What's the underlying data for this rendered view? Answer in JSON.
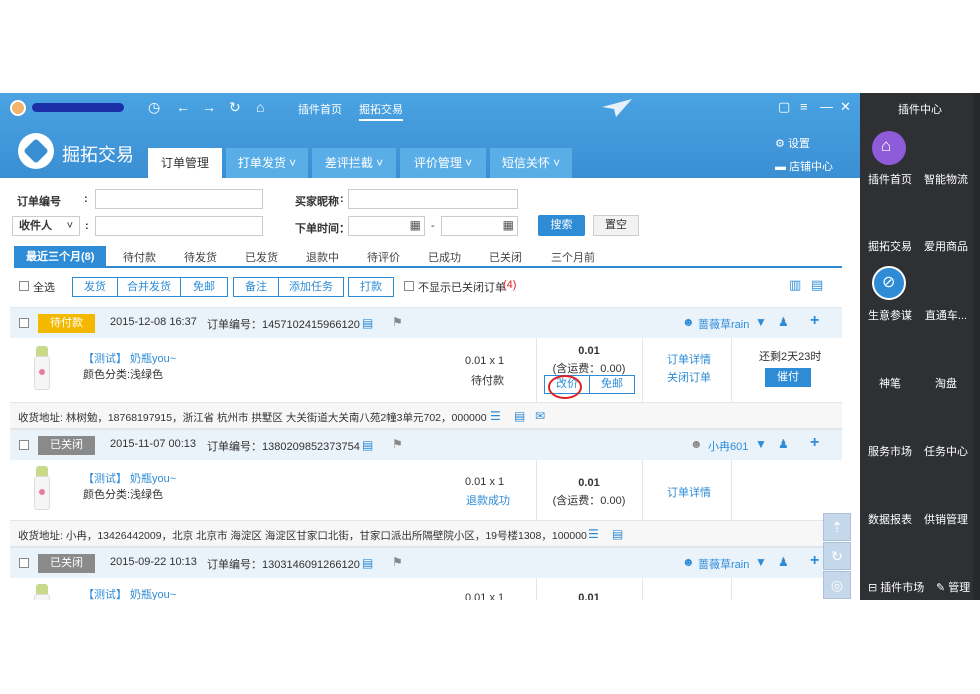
{
  "top": {
    "links": [
      "插件首页",
      "掘拓交易"
    ],
    "brand": "掘拓交易",
    "settings": "设置",
    "shop_center": "店铺中心"
  },
  "main_tabs": [
    "订单管理",
    "打单发货",
    "差评拦截",
    "评价管理",
    "短信关怀"
  ],
  "filters": {
    "order_no_label": "订单编号",
    "buyer_label": "买家昵称",
    "receiver_label": "收件人",
    "order_time_label": "下单时间：",
    "colon": ":",
    "dash": "-",
    "search": "搜索",
    "reset": "置空"
  },
  "status_tabs": [
    "最近三个月(8)",
    "待付款",
    "待发货",
    "已发货",
    "退款中",
    "待评价",
    "已成功",
    "已关闭",
    "三个月前"
  ],
  "actions": {
    "select_all": "全选",
    "buttons": [
      "发货",
      "合并发货",
      "免邮",
      "备注",
      "添加任务",
      "打款"
    ],
    "hide_closed": "不显示已关闭订单",
    "hide_closed_count": "(4)"
  },
  "orders": [
    {
      "status": "待付款",
      "status_color": "#f5b800",
      "date": "2015-12-08 16:37",
      "order_no": "订单编号：1457102415966120",
      "buyer": "蔷薇草rain",
      "product_title": "【测试】 奶瓶you~",
      "product_attr": "颜色分类:浅绿色",
      "qty": "0.01 x 1",
      "item_status": "待付款",
      "price": "0.01",
      "shipping": "(含运费：0.00)",
      "btn_change_price": "改价",
      "btn_free_ship": "免邮",
      "link_detail": "订单详情",
      "link_close": "关闭订单",
      "remaining": "还剩2天23时",
      "btn_rush": "催付",
      "address": "收货地址: 林树勉，18768197915，浙江省 杭州市 拱墅区 大关街道大关南八苑2幢3单元702，000000"
    },
    {
      "status": "已关闭",
      "status_color": "#8a8a8a",
      "date": "2015-11-07 00:13",
      "order_no": "订单编号：1380209852373754",
      "buyer": "小冉601",
      "product_title": "【测试】 奶瓶you~",
      "product_attr": "颜色分类:浅绿色",
      "qty": "0.01 x 1",
      "item_status": "退款成功",
      "price": "0.01",
      "shipping": "(含运费：0.00)",
      "link_detail": "订单详情",
      "address": "收货地址: 小冉，13426442009，北京 北京市 海淀区 海淀区甘家口北街，甘家口派出所隔壁院小区，19号楼1308，100000"
    },
    {
      "status": "已关闭",
      "status_color": "#8a8a8a",
      "date": "2015-09-22 10:13",
      "order_no": "订单编号：1303146091266120",
      "buyer": "蔷薇草rain",
      "product_title": "【测试】 奶瓶you~",
      "qty": "0.01 x 1",
      "price": "0.01"
    }
  ],
  "right_panel": {
    "title": "插件中心",
    "items": [
      "插件首页",
      "智能物流",
      "掘拓交易",
      "爱用商品",
      "生意参谋",
      "直通车...",
      "神笔",
      "淘盘",
      "服务市场",
      "任务中心",
      "数据报表",
      "供销管理"
    ],
    "bottom_left": "插件市场",
    "bottom_right": "管理",
    "circle_colors": [
      "#8e5cd9",
      "#2e8bd6"
    ]
  }
}
